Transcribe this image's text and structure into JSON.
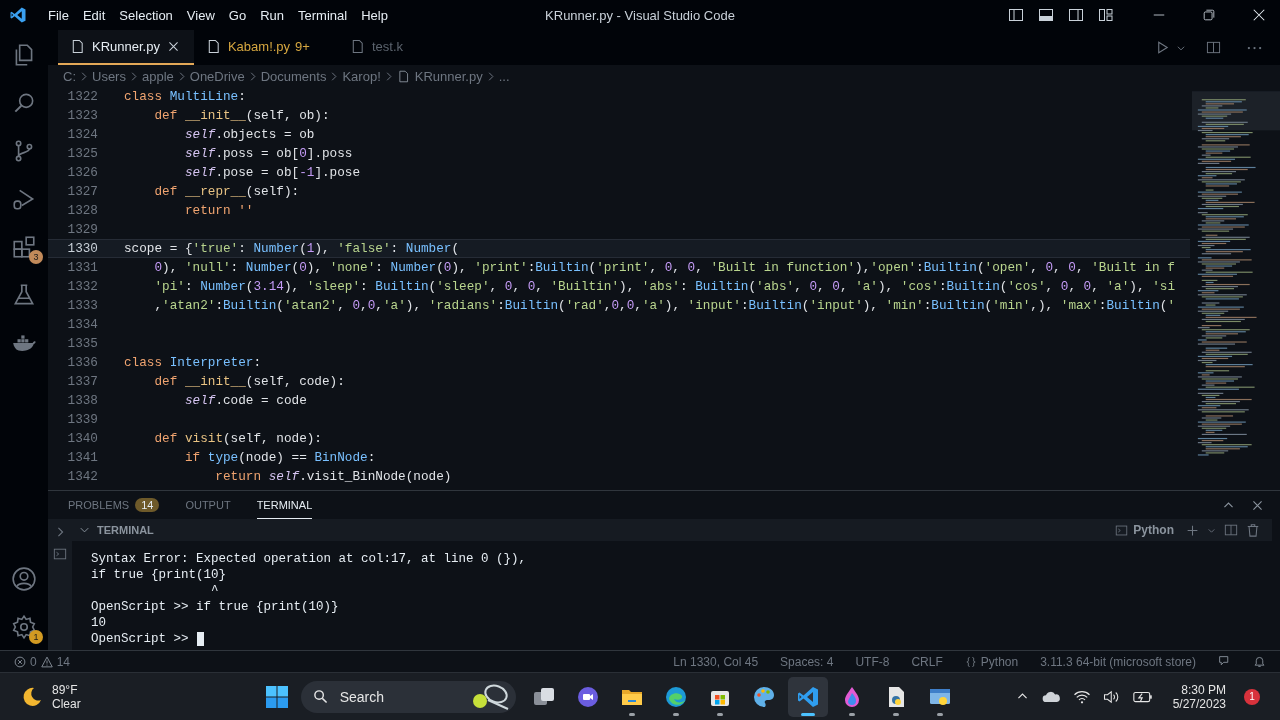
{
  "title_bar": {
    "menu": [
      "File",
      "Edit",
      "Selection",
      "View",
      "Go",
      "Run",
      "Terminal",
      "Help"
    ],
    "title": "KRunner.py - Visual Studio Code"
  },
  "activity_bar": {
    "extensions_badge": "3",
    "settings_badge": "1"
  },
  "tabs": [
    {
      "label": "KRunner.py",
      "selected": true,
      "faded": false
    },
    {
      "label": "Kabam!.py",
      "problems": "9+",
      "selected": false,
      "faded": false
    },
    {
      "label": "test.k",
      "selected": false,
      "faded": true
    }
  ],
  "breadcrumbs": [
    "C:",
    "Users",
    "apple",
    "OneDrive",
    "Documents",
    "Karop!",
    "KRunner.py",
    "..."
  ],
  "editor": {
    "lines": [
      {
        "number": "1322",
        "current": false,
        "tokens": [
          {
            "kind": "kw",
            "text": "class "
          },
          {
            "kind": "cls",
            "text": "MultiLine"
          },
          {
            "kind": "p",
            "text": ":"
          }
        ]
      },
      {
        "number": "1323",
        "current": false,
        "tokens": [
          {
            "kind": "kw",
            "text": "    def "
          },
          {
            "kind": "fn",
            "text": "__init__"
          },
          {
            "kind": "p",
            "text": "(self, ob):"
          }
        ]
      },
      {
        "number": "1324",
        "current": false,
        "tokens": [
          {
            "kind": "self",
            "text": "        self"
          },
          {
            "kind": "p",
            "text": ".objects = ob"
          }
        ]
      },
      {
        "number": "1325",
        "current": false,
        "tokens": [
          {
            "kind": "self",
            "text": "        self"
          },
          {
            "kind": "p",
            "text": ".poss = ob["
          },
          {
            "kind": "num",
            "text": "0"
          },
          {
            "kind": "p",
            "text": "].poss"
          }
        ]
      },
      {
        "number": "1326",
        "current": false,
        "tokens": [
          {
            "kind": "self",
            "text": "        self"
          },
          {
            "kind": "p",
            "text": ".pose = ob["
          },
          {
            "kind": "num",
            "text": "-1"
          },
          {
            "kind": "p",
            "text": "].pose"
          }
        ]
      },
      {
        "number": "1327",
        "current": false,
        "tokens": [
          {
            "kind": "kw",
            "text": "    def "
          },
          {
            "kind": "fn",
            "text": "__repr__"
          },
          {
            "kind": "p",
            "text": "(self):"
          }
        ]
      },
      {
        "number": "1328",
        "current": false,
        "tokens": [
          {
            "kind": "kw",
            "text": "        return ''"
          }
        ]
      },
      {
        "number": "1329",
        "current": false
      },
      {
        "number": "1330",
        "current": true,
        "tokens": [
          {
            "kind": "p",
            "text": "scope = {"
          },
          {
            "kind": "str",
            "text": "'true'"
          },
          {
            "kind": "p",
            "text": ": "
          },
          {
            "kind": "cls",
            "text": "Number"
          },
          {
            "kind": "p",
            "text": "("
          },
          {
            "kind": "num",
            "text": "1"
          },
          {
            "kind": "p",
            "text": "), "
          },
          {
            "kind": "str",
            "text": "'false'"
          },
          {
            "kind": "p",
            "text": ": "
          },
          {
            "kind": "cls",
            "text": "Number"
          },
          {
            "kind": "p",
            "text": "("
          }
        ]
      },
      {
        "number": "1331",
        "current": false,
        "tokens": [
          {
            "kind": "num",
            "text": "    0"
          },
          {
            "kind": "p",
            "text": "), "
          },
          {
            "kind": "str",
            "text": "'null'"
          },
          {
            "kind": "p",
            "text": ": "
          },
          {
            "kind": "cls",
            "text": "Number"
          },
          {
            "kind": "p",
            "text": "("
          },
          {
            "kind": "num",
            "text": "0"
          },
          {
            "kind": "p",
            "text": "), "
          },
          {
            "kind": "str",
            "text": "'none'"
          },
          {
            "kind": "p",
            "text": ": "
          },
          {
            "kind": "cls",
            "text": "Number"
          },
          {
            "kind": "p",
            "text": "("
          },
          {
            "kind": "num",
            "text": "0"
          },
          {
            "kind": "p",
            "text": "), "
          },
          {
            "kind": "str",
            "text": "'print'"
          },
          {
            "kind": "p",
            "text": ":"
          },
          {
            "kind": "cls",
            "text": "Builtin"
          },
          {
            "kind": "p",
            "text": "("
          },
          {
            "kind": "str",
            "text": "'print'"
          },
          {
            "kind": "p",
            "text": ", "
          },
          {
            "kind": "num",
            "text": "0"
          },
          {
            "kind": "p",
            "text": ", "
          },
          {
            "kind": "num",
            "text": "0"
          },
          {
            "kind": "p",
            "text": ", "
          },
          {
            "kind": "str",
            "text": "'Built in function'"
          },
          {
            "kind": "p",
            "text": "),"
          },
          {
            "kind": "str",
            "text": "'open'"
          },
          {
            "kind": "p",
            "text": ":"
          },
          {
            "kind": "cls",
            "text": "Builtin"
          },
          {
            "kind": "p",
            "text": "("
          },
          {
            "kind": "str",
            "text": "'open'"
          },
          {
            "kind": "p",
            "text": ", "
          },
          {
            "kind": "num",
            "text": "0"
          },
          {
            "kind": "p",
            "text": ", "
          },
          {
            "kind": "num",
            "text": "0"
          },
          {
            "kind": "p",
            "text": ", "
          },
          {
            "kind": "str",
            "text": "'Built in f"
          }
        ]
      },
      {
        "number": "1332",
        "current": false,
        "tokens": [
          {
            "kind": "str",
            "text": "    'pi'"
          },
          {
            "kind": "p",
            "text": ": "
          },
          {
            "kind": "cls",
            "text": "Number"
          },
          {
            "kind": "p",
            "text": "("
          },
          {
            "kind": "num",
            "text": "3.14"
          },
          {
            "kind": "p",
            "text": "), "
          },
          {
            "kind": "str",
            "text": "'sleep'"
          },
          {
            "kind": "p",
            "text": ": "
          },
          {
            "kind": "cls",
            "text": "Builtin"
          },
          {
            "kind": "p",
            "text": "("
          },
          {
            "kind": "str",
            "text": "'sleep'"
          },
          {
            "kind": "p",
            "text": ", "
          },
          {
            "kind": "num",
            "text": "0"
          },
          {
            "kind": "p",
            "text": ", "
          },
          {
            "kind": "num",
            "text": "0"
          },
          {
            "kind": "p",
            "text": ", "
          },
          {
            "kind": "str",
            "text": "'Builtin'"
          },
          {
            "kind": "p",
            "text": "), "
          },
          {
            "kind": "str",
            "text": "'abs'"
          },
          {
            "kind": "p",
            "text": ": "
          },
          {
            "kind": "cls",
            "text": "Builtin"
          },
          {
            "kind": "p",
            "text": "("
          },
          {
            "kind": "str",
            "text": "'abs'"
          },
          {
            "kind": "p",
            "text": ", "
          },
          {
            "kind": "num",
            "text": "0"
          },
          {
            "kind": "p",
            "text": ", "
          },
          {
            "kind": "num",
            "text": "0"
          },
          {
            "kind": "p",
            "text": ", "
          },
          {
            "kind": "str",
            "text": "'a'"
          },
          {
            "kind": "p",
            "text": "), "
          },
          {
            "kind": "str",
            "text": "'cos'"
          },
          {
            "kind": "p",
            "text": ":"
          },
          {
            "kind": "cls",
            "text": "Builtin"
          },
          {
            "kind": "p",
            "text": "("
          },
          {
            "kind": "str",
            "text": "'cos'"
          },
          {
            "kind": "p",
            "text": ", "
          },
          {
            "kind": "num",
            "text": "0"
          },
          {
            "kind": "p",
            "text": ", "
          },
          {
            "kind": "num",
            "text": "0"
          },
          {
            "kind": "p",
            "text": ", "
          },
          {
            "kind": "str",
            "text": "'a'"
          },
          {
            "kind": "p",
            "text": "), "
          },
          {
            "kind": "str",
            "text": "'si"
          }
        ]
      },
      {
        "number": "1333",
        "current": false,
        "tokens": [
          {
            "kind": "p",
            "text": "    ,"
          },
          {
            "kind": "str",
            "text": "'atan2'"
          },
          {
            "kind": "p",
            "text": ":"
          },
          {
            "kind": "cls",
            "text": "Builtin"
          },
          {
            "kind": "p",
            "text": "("
          },
          {
            "kind": "str",
            "text": "'atan2'"
          },
          {
            "kind": "p",
            "text": ", "
          },
          {
            "kind": "num",
            "text": "0"
          },
          {
            "kind": "p",
            "text": ","
          },
          {
            "kind": "num",
            "text": "0"
          },
          {
            "kind": "p",
            "text": ","
          },
          {
            "kind": "str",
            "text": "'a'"
          },
          {
            "kind": "p",
            "text": "), "
          },
          {
            "kind": "str",
            "text": "'radians'"
          },
          {
            "kind": "p",
            "text": ":"
          },
          {
            "kind": "cls",
            "text": "Builtin"
          },
          {
            "kind": "p",
            "text": "("
          },
          {
            "kind": "str",
            "text": "'rad'"
          },
          {
            "kind": "p",
            "text": ","
          },
          {
            "kind": "num",
            "text": "0"
          },
          {
            "kind": "p",
            "text": ","
          },
          {
            "kind": "num",
            "text": "0"
          },
          {
            "kind": "p",
            "text": ","
          },
          {
            "kind": "str",
            "text": "'a'"
          },
          {
            "kind": "p",
            "text": "), "
          },
          {
            "kind": "str",
            "text": "'input'"
          },
          {
            "kind": "p",
            "text": ":"
          },
          {
            "kind": "cls",
            "text": "Builtin"
          },
          {
            "kind": "p",
            "text": "("
          },
          {
            "kind": "str",
            "text": "'input'"
          },
          {
            "kind": "p",
            "text": "), "
          },
          {
            "kind": "str",
            "text": "'min'"
          },
          {
            "kind": "p",
            "text": ":"
          },
          {
            "kind": "cls",
            "text": "Builtin"
          },
          {
            "kind": "p",
            "text": "("
          },
          {
            "kind": "str",
            "text": "'min'"
          },
          {
            "kind": "p",
            "text": ",), "
          },
          {
            "kind": "str",
            "text": "'max'"
          },
          {
            "kind": "p",
            "text": ":"
          },
          {
            "kind": "cls",
            "text": "Builtin"
          },
          {
            "kind": "p",
            "text": "("
          },
          {
            "kind": "str",
            "text": "'"
          }
        ]
      },
      {
        "number": "1334",
        "current": false
      },
      {
        "number": "1335",
        "current": false
      },
      {
        "number": "1336",
        "current": false,
        "tokens": [
          {
            "kind": "kw",
            "text": "class "
          },
          {
            "kind": "cls",
            "text": "Interpreter"
          },
          {
            "kind": "p",
            "text": ":"
          }
        ]
      },
      {
        "number": "1337",
        "current": false,
        "tokens": [
          {
            "kind": "kw",
            "text": "    def "
          },
          {
            "kind": "fn",
            "text": "__init__"
          },
          {
            "kind": "p",
            "text": "(self, code):"
          }
        ]
      },
      {
        "number": "1338",
        "current": false,
        "tokens": [
          {
            "kind": "self",
            "text": "        self"
          },
          {
            "kind": "p",
            "text": ".code = code"
          }
        ]
      },
      {
        "number": "1339",
        "current": false
      },
      {
        "number": "1340",
        "current": false,
        "tokens": [
          {
            "kind": "kw",
            "text": "    def "
          },
          {
            "kind": "fn",
            "text": "visit"
          },
          {
            "kind": "p",
            "text": "(self, node):"
          }
        ]
      },
      {
        "number": "1341",
        "current": false,
        "tokens": [
          {
            "kind": "kw",
            "text": "        if "
          },
          {
            "kind": "cls",
            "text": "type"
          },
          {
            "kind": "p",
            "text": "(node) == "
          },
          {
            "kind": "cls",
            "text": "BinNode"
          },
          {
            "kind": "p",
            "text": ":"
          }
        ]
      },
      {
        "number": "1342",
        "current": false,
        "tokens": [
          {
            "kind": "kw",
            "text": "            return "
          },
          {
            "kind": "self",
            "text": "self"
          },
          {
            "kind": "p",
            "text": ".visit_BinNode(node)"
          }
        ]
      }
    ]
  },
  "panel": {
    "tabs": [
      {
        "label": "PROBLEMS",
        "badge": "14",
        "selected": false
      },
      {
        "label": "OUTPUT",
        "selected": false
      },
      {
        "label": "TERMINAL",
        "selected": true
      }
    ],
    "section": "TERMINAL",
    "shell": "Python",
    "terminal_lines": [
      "Syntax Error: Expected operation at col:17, at line 0 (}),",
      "if true {print(10}",
      "                ^",
      "OpenScript >> if true {print(10)}",
      "10"
    ],
    "prompt": "OpenScript >>"
  },
  "status_bar": {
    "errors": "0",
    "warnings": "14",
    "items": [
      {
        "kind": "text",
        "text": "Ln 1330, Col 45"
      },
      {
        "kind": "text",
        "text": "Spaces: 4"
      },
      {
        "kind": "text",
        "text": "UTF-8"
      },
      {
        "kind": "text",
        "text": "CRLF"
      },
      {
        "kind": "language",
        "text": "Python"
      },
      {
        "kind": "text",
        "text": "3.11.3 64-bit (microsoft store)"
      }
    ]
  },
  "taskbar": {
    "weather": {
      "temperature": "89°F",
      "condition": "Clear"
    },
    "search_placeholder": "Search",
    "apps": [
      {
        "kind": "task-view",
        "running": false,
        "active": false
      },
      {
        "kind": "chat",
        "running": false,
        "active": false
      },
      {
        "kind": "folder",
        "running": true,
        "active": false
      },
      {
        "kind": "browser",
        "running": true,
        "active": false
      },
      {
        "kind": "store",
        "running": true,
        "active": false
      },
      {
        "kind": "palette",
        "running": false,
        "active": false
      },
      {
        "kind": "code",
        "running": true,
        "active": true
      },
      {
        "kind": "drop",
        "running": true,
        "active": false
      },
      {
        "kind": "document",
        "running": true,
        "active": false
      },
      {
        "kind": "window",
        "running": true,
        "active": false
      }
    ],
    "time": "8:30 PM",
    "date": "5/27/2023",
    "notifications": "1"
  }
}
